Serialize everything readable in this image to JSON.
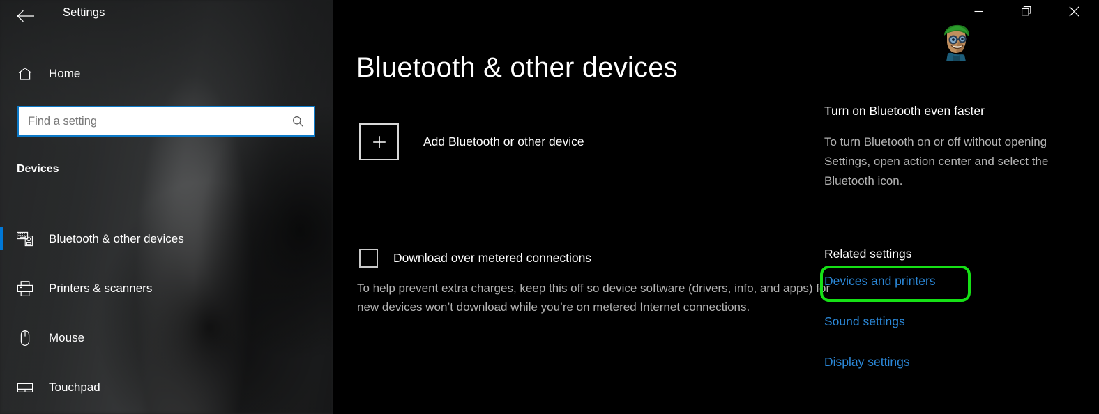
{
  "window": {
    "app_title": "Settings",
    "back_icon": "back-arrow-icon",
    "minimize_label": "Minimize",
    "maximize_label": "Restore",
    "close_label": "Close",
    "watermark_icon": "cartoon-avatar-watermark"
  },
  "sidebar": {
    "home": {
      "label": "Home",
      "icon": "home-icon"
    },
    "search": {
      "value": "",
      "placeholder": "Find a setting",
      "icon": "search-icon"
    },
    "section_header": "Devices",
    "items": [
      {
        "label": "Bluetooth & other devices",
        "icon": "devices-icon",
        "selected": true
      },
      {
        "label": "Printers & scanners",
        "icon": "printer-icon",
        "selected": false
      },
      {
        "label": "Mouse",
        "icon": "mouse-icon",
        "selected": false
      },
      {
        "label": "Touchpad",
        "icon": "touchpad-icon",
        "selected": false
      }
    ]
  },
  "main": {
    "page_title": "Bluetooth & other devices",
    "add_device": {
      "label": "Add Bluetooth or other device",
      "icon": "plus-icon"
    },
    "metered": {
      "label": "Download over metered connections",
      "checked": false,
      "description": "To help prevent extra charges, keep this off so device software (drivers, info, and apps) for new devices won’t download while you’re on metered Internet connections."
    }
  },
  "right_panel": {
    "tip_title": "Turn on Bluetooth even faster",
    "tip_body": "To turn Bluetooth on or off without opening Settings, open action center and select the Bluetooth icon.",
    "related_title": "Related settings",
    "links": [
      {
        "label": "Devices and printers",
        "highlighted": true
      },
      {
        "label": "Sound settings",
        "highlighted": false
      },
      {
        "label": "Display settings",
        "highlighted": false
      }
    ]
  },
  "colors": {
    "accent_blue": "#0078d7",
    "link_blue": "#2b88d8",
    "annotation_green": "#16e016",
    "search_border": "#0d7ac8",
    "sidebar_base": "#2b2b2d",
    "main_background": "#000000",
    "muted_text": "#b3b3b3"
  }
}
